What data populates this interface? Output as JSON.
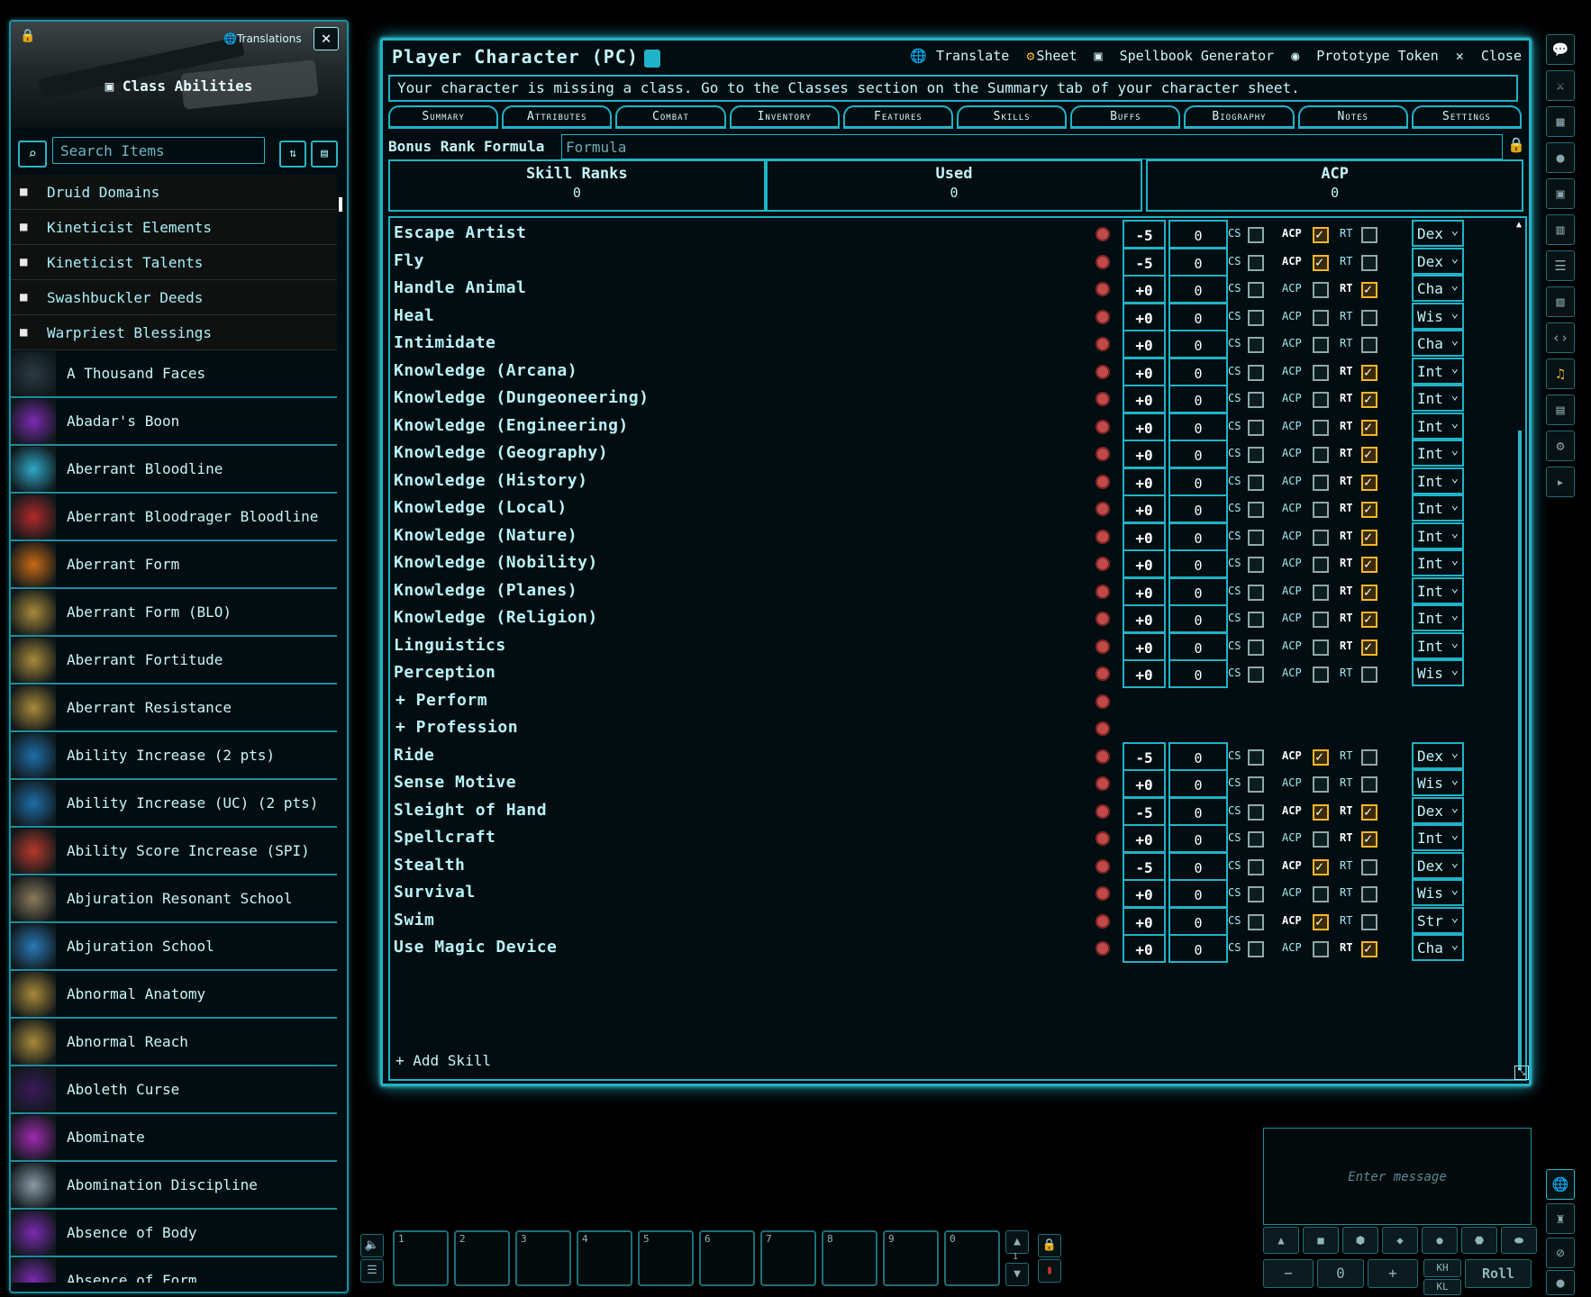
{
  "sidebar": {
    "translations_label": "Translations",
    "title": "Class Abilities",
    "search_placeholder": "Search Items",
    "folders": [
      "Druid Domains",
      "Kineticist Elements",
      "Kineticist Talents",
      "Swashbuckler Deeds",
      "Warpriest Blessings"
    ],
    "items": [
      {
        "label": "A Thousand Faces",
        "color": "#2a3a44"
      },
      {
        "label": "Abadar's Boon",
        "color": "#7a2bb0"
      },
      {
        "label": "Aberrant Bloodline",
        "color": "#2fa8c8"
      },
      {
        "label": "Aberrant Bloodrager Bloodline",
        "color": "#b02a2a"
      },
      {
        "label": "Aberrant Form",
        "color": "#c86a14"
      },
      {
        "label": "Aberrant Form (BLO)",
        "color": "#a88a3a"
      },
      {
        "label": "Aberrant Fortitude",
        "color": "#a88a3a"
      },
      {
        "label": "Aberrant Resistance",
        "color": "#a88a3a"
      },
      {
        "label": "Ability Increase (2 pts)",
        "color": "#1e6ea8"
      },
      {
        "label": "Ability Increase (UC) (2 pts)",
        "color": "#1e6ea8"
      },
      {
        "label": "Ability Score Increase (SPI)",
        "color": "#b83a2a"
      },
      {
        "label": "Abjuration Resonant School",
        "color": "#8a7a5a"
      },
      {
        "label": "Abjuration School",
        "color": "#2a7ab8"
      },
      {
        "label": "Abnormal Anatomy",
        "color": "#a88a3a"
      },
      {
        "label": "Abnormal Reach",
        "color": "#a88a3a"
      },
      {
        "label": "Aboleth Curse",
        "color": "#3a1a5a"
      },
      {
        "label": "Abominate",
        "color": "#a02ab0"
      },
      {
        "label": "Abomination Discipline",
        "color": "#8a9aa8"
      },
      {
        "label": "Absence of Body",
        "color": "#7a2bb0"
      },
      {
        "label": "Absence of Form",
        "color": "#7a2bb0"
      }
    ]
  },
  "window": {
    "title": "Player Character (PC)",
    "controls": [
      "Translate",
      "Sheet",
      "Spellbook Generator",
      "Prototype Token",
      "Close"
    ],
    "warning": "Your character is missing a class. Go to the Classes section on the Summary tab of your character sheet.",
    "tabs": [
      "Summary",
      "Attributes",
      "Combat",
      "Inventory",
      "Features",
      "Skills",
      "Buffs",
      "Biography",
      "Notes",
      "Settings"
    ],
    "bonus_rank_label": "Bonus Rank Formula",
    "bonus_rank_placeholder": "Formula",
    "summary": [
      {
        "header": "Skill Ranks",
        "value": "0"
      },
      {
        "header": "Used",
        "value": "0"
      },
      {
        "header": "ACP",
        "value": "0"
      }
    ],
    "add_skill": "Add Skill",
    "labels": {
      "cs": "CS",
      "acp": "ACP",
      "rt": "RT"
    }
  },
  "skills": [
    {
      "name": "Escape Artist",
      "mod": "-5",
      "rank": "0",
      "cs": false,
      "acp": true,
      "rt": false,
      "ability": "Dex"
    },
    {
      "name": "Fly",
      "mod": "-5",
      "rank": "0",
      "cs": false,
      "acp": true,
      "rt": false,
      "ability": "Dex"
    },
    {
      "name": "Handle Animal",
      "mod": "+0",
      "rank": "0",
      "cs": false,
      "acp": false,
      "rt": true,
      "ability": "Cha"
    },
    {
      "name": "Heal",
      "mod": "+0",
      "rank": "0",
      "cs": false,
      "acp": false,
      "rt": false,
      "ability": "Wis"
    },
    {
      "name": "Intimidate",
      "mod": "+0",
      "rank": "0",
      "cs": false,
      "acp": false,
      "rt": false,
      "ability": "Cha"
    },
    {
      "name": "Knowledge (Arcana)",
      "mod": "+0",
      "rank": "0",
      "cs": false,
      "acp": false,
      "rt": true,
      "ability": "Int"
    },
    {
      "name": "Knowledge (Dungeoneering)",
      "mod": "+0",
      "rank": "0",
      "cs": false,
      "acp": false,
      "rt": true,
      "ability": "Int"
    },
    {
      "name": "Knowledge (Engineering)",
      "mod": "+0",
      "rank": "0",
      "cs": false,
      "acp": false,
      "rt": true,
      "ability": "Int"
    },
    {
      "name": "Knowledge (Geography)",
      "mod": "+0",
      "rank": "0",
      "cs": false,
      "acp": false,
      "rt": true,
      "ability": "Int"
    },
    {
      "name": "Knowledge (History)",
      "mod": "+0",
      "rank": "0",
      "cs": false,
      "acp": false,
      "rt": true,
      "ability": "Int"
    },
    {
      "name": "Knowledge (Local)",
      "mod": "+0",
      "rank": "0",
      "cs": false,
      "acp": false,
      "rt": true,
      "ability": "Int"
    },
    {
      "name": "Knowledge (Nature)",
      "mod": "+0",
      "rank": "0",
      "cs": false,
      "acp": false,
      "rt": true,
      "ability": "Int"
    },
    {
      "name": "Knowledge (Nobility)",
      "mod": "+0",
      "rank": "0",
      "cs": false,
      "acp": false,
      "rt": true,
      "ability": "Int"
    },
    {
      "name": "Knowledge (Planes)",
      "mod": "+0",
      "rank": "0",
      "cs": false,
      "acp": false,
      "rt": true,
      "ability": "Int"
    },
    {
      "name": "Knowledge (Religion)",
      "mod": "+0",
      "rank": "0",
      "cs": false,
      "acp": false,
      "rt": true,
      "ability": "Int"
    },
    {
      "name": "Linguistics",
      "mod": "+0",
      "rank": "0",
      "cs": false,
      "acp": false,
      "rt": true,
      "ability": "Int"
    },
    {
      "name": "Perception",
      "mod": "+0",
      "rank": "0",
      "cs": false,
      "acp": false,
      "rt": false,
      "ability": "Wis"
    },
    {
      "name": "+ Perform",
      "group": true
    },
    {
      "name": "+ Profession",
      "group": true
    },
    {
      "name": "Ride",
      "mod": "-5",
      "rank": "0",
      "cs": false,
      "acp": true,
      "rt": false,
      "ability": "Dex"
    },
    {
      "name": "Sense Motive",
      "mod": "+0",
      "rank": "0",
      "cs": false,
      "acp": false,
      "rt": false,
      "ability": "Wis"
    },
    {
      "name": "Sleight of Hand",
      "mod": "-5",
      "rank": "0",
      "cs": false,
      "acp": true,
      "rt": true,
      "ability": "Dex"
    },
    {
      "name": "Spellcraft",
      "mod": "+0",
      "rank": "0",
      "cs": false,
      "acp": false,
      "rt": true,
      "ability": "Int"
    },
    {
      "name": "Stealth",
      "mod": "-5",
      "rank": "0",
      "cs": false,
      "acp": true,
      "rt": false,
      "ability": "Dex"
    },
    {
      "name": "Survival",
      "mod": "+0",
      "rank": "0",
      "cs": false,
      "acp": false,
      "rt": false,
      "ability": "Wis"
    },
    {
      "name": "Swim",
      "mod": "+0",
      "rank": "0",
      "cs": false,
      "acp": true,
      "rt": false,
      "ability": "Str"
    },
    {
      "name": "Use Magic Device",
      "mod": "+0",
      "rank": "0",
      "cs": false,
      "acp": false,
      "rt": true,
      "ability": "Cha"
    }
  ],
  "chat": {
    "placeholder": "Enter message",
    "roll_label": "Roll",
    "roll_value": "0",
    "kh": "KH",
    "kl": "KL"
  },
  "hotbar": {
    "slots": [
      "1",
      "2",
      "3",
      "4",
      "5",
      "6",
      "7",
      "8",
      "9",
      "0"
    ],
    "page": "1"
  }
}
